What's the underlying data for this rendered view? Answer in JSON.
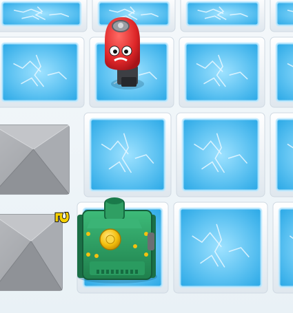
{
  "board": {
    "tile_types": {
      "ice": "ice-tile",
      "block": "stone-block"
    },
    "tiles": [
      {
        "row": 0,
        "col": 0,
        "type": "ice"
      },
      {
        "row": 0,
        "col": 1,
        "type": "ice"
      },
      {
        "row": 0,
        "col": 2,
        "type": "ice"
      },
      {
        "row": 0,
        "col": 3,
        "type": "ice"
      },
      {
        "row": 1,
        "col": 0,
        "type": "ice"
      },
      {
        "row": 1,
        "col": 1,
        "type": "ice"
      },
      {
        "row": 1,
        "col": 2,
        "type": "ice"
      },
      {
        "row": 1,
        "col": 3,
        "type": "ice"
      },
      {
        "row": 2,
        "col": 0,
        "type": "block"
      },
      {
        "row": 2,
        "col": 1,
        "type": "ice"
      },
      {
        "row": 2,
        "col": 2,
        "type": "ice"
      },
      {
        "row": 2,
        "col": 3,
        "type": "ice"
      },
      {
        "row": 3,
        "col": 0,
        "type": "block"
      },
      {
        "row": 3,
        "col": 1,
        "type": "ice"
      },
      {
        "row": 3,
        "col": 2,
        "type": "ice"
      },
      {
        "row": 3,
        "col": 3,
        "type": "ice"
      }
    ]
  },
  "units": {
    "enemy_robot": {
      "name": "red-robot",
      "icon": "red-robot-icon"
    },
    "player_tank": {
      "name": "green-tank",
      "icon": "green-tank-icon"
    }
  },
  "hud": {
    "tank_number": "5",
    "tank_number_color": "#f5d000"
  },
  "colors": {
    "ice_light": "#e8f8ff",
    "ice_blue": "#5fc3f2",
    "ice_deep": "#2aa8e6",
    "stone": "#a6a9ae",
    "stone_dark": "#8d9096",
    "robot_red": "#dd2628",
    "tank_green": "#2c9d62",
    "tank_yellow": "#f4c10f"
  }
}
